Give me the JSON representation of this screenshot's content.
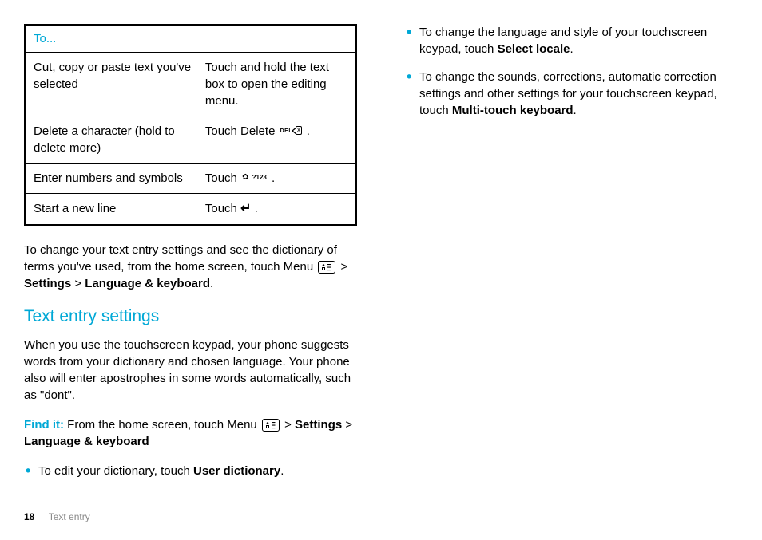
{
  "table": {
    "header": "To...",
    "rows": [
      {
        "col1": "Cut, copy or paste text you've selected",
        "col2_text": "Touch and hold the text box to open the editing menu."
      },
      {
        "col1": "Delete a character (hold to delete more)",
        "col2_prefix": "Touch Delete ",
        "col2_suffix": ".",
        "icon": "delete",
        "icon_label": "DEL",
        "icon_inner": "X"
      },
      {
        "col1": "Enter numbers and symbols",
        "col2_prefix": "Touch ",
        "col2_suffix": ".",
        "icon": "symbols",
        "icon_label": "?123"
      },
      {
        "col1": "Start a new line",
        "col2_prefix": "Touch ",
        "col2_suffix": ".",
        "icon": "enter"
      }
    ]
  },
  "para1": {
    "pre": "To change your text entry settings and see the dictionary of terms you've used, from the home screen, touch Menu ",
    "post1": " > ",
    "bold1": "Settings",
    "mid": " > ",
    "bold2": "Language & keyboard",
    "end": "."
  },
  "heading": "Text entry settings",
  "para2": "When you use the touchscreen keypad, your phone suggests words from your dictionary and chosen language. Your phone also will enter apostrophes in some words automatically, such as \"dont\".",
  "findit": {
    "label": "Find it:",
    "text1": " From the home screen, touch Menu ",
    "text2": " > ",
    "bold1": "Settings",
    "mid": " > ",
    "bold2": "Language & keyboard"
  },
  "bullets_left": [
    {
      "pre": "To edit your dictionary, touch ",
      "bold": "User dictionary",
      "post": "."
    }
  ],
  "bullets_right": [
    {
      "pre": "To change the language and style of your touchscreen keypad, touch ",
      "bold": "Select locale",
      "post": "."
    },
    {
      "pre": "To change the sounds, corrections, automatic correction settings and other settings for your touchscreen keypad, touch ",
      "bold": "Multi-touch keyboard",
      "post": "."
    }
  ],
  "footer": {
    "page": "18",
    "section": "Text entry"
  }
}
